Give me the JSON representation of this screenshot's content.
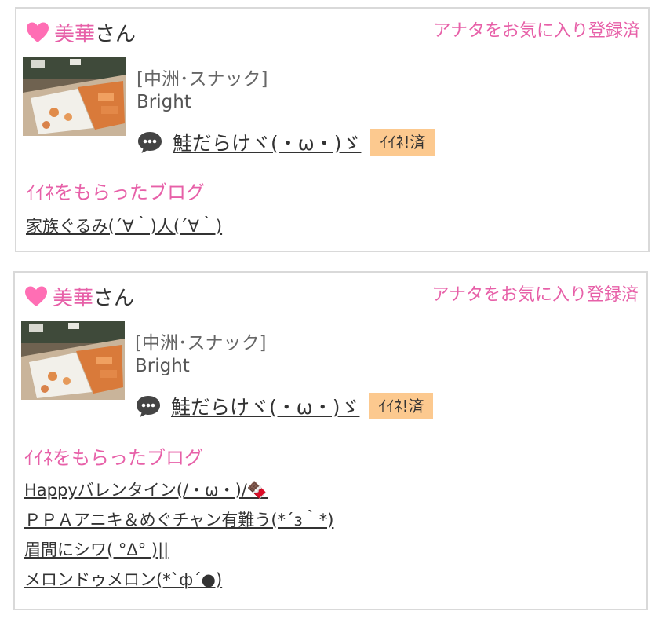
{
  "cards": [
    {
      "name": "美華",
      "honorific": "さん",
      "favorite_status": "アナタをお気に入り登録済",
      "category": "[中洲･スナック]",
      "shop": "Bright",
      "post_title": "鮭だらけヾ(・ω・)ゞ",
      "iine_badge": "ｲｲﾈ!済",
      "section_title": "ｲｲﾈをもらったブログ",
      "blogs": [
        "家族ぐるみ(´∀｀)人(´∀｀)"
      ]
    },
    {
      "name": "美華",
      "honorific": "さん",
      "favorite_status": "アナタをお気に入り登録済",
      "category": "[中洲･スナック]",
      "shop": "Bright",
      "post_title": "鮭だらけヾ(・ω・)ゞ",
      "iine_badge": "ｲｲﾈ!済",
      "section_title": "ｲｲﾈをもらったブログ",
      "blogs": [
        "Happyバレンタイン(/・ω・)/🍫",
        "ＰＰＡアニキ＆めぐチャン有難う(*´з｀*)",
        "眉間にシワ( °Δ° )||",
        "メロンドゥメロン(*`ф´●)"
      ]
    }
  ],
  "colors": {
    "accent_pink": "#e760a8",
    "badge_bg": "#fcc98f",
    "border": "#d9d9d9"
  },
  "icons": {
    "favorite": "heart-icon",
    "comment": "speech-bubble-icon"
  }
}
